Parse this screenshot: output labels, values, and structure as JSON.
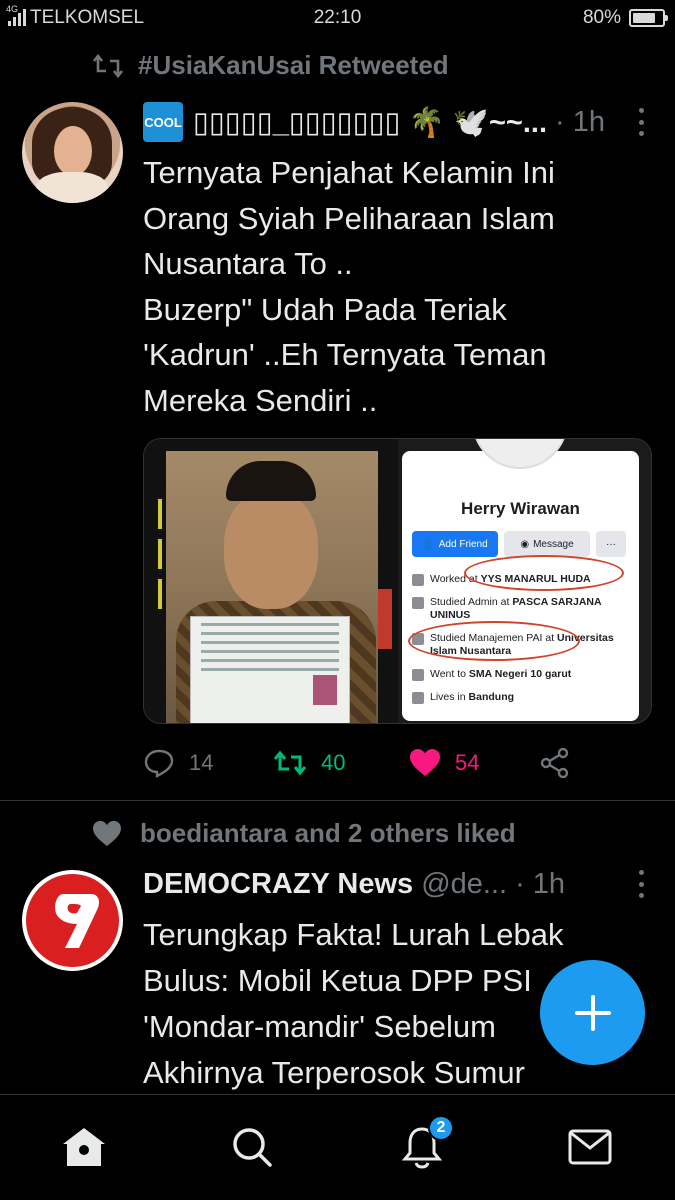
{
  "status_bar": {
    "network": "4G",
    "carrier": "TELKOMSEL",
    "time": "22:10",
    "battery": "80%",
    "battery_level": 0.8
  },
  "tweets": [
    {
      "social_context": "#UsiaKanUsai Retweeted",
      "display_name": "▯▯▯▯▯_▯▯▯▯▯▯▯ 🌴 🕊️~~...",
      "badge": "COOL",
      "separator": "·",
      "time": "1h",
      "text_lines": [
        "Ternyata Penjahat Kelamin Ini",
        "Orang Syiah Peliharaan Islam",
        "Nusantara To ..",
        "Buzerp\" Udah Pada Teriak",
        "'Kadrun' ..Eh Ternyata Teman",
        "Mereka Sendiri .."
      ],
      "media": {
        "profile_name": "Herry Wirawan",
        "add_friend": "Add Friend",
        "message": "Message",
        "more": "···",
        "details": [
          {
            "prefix": "Worked at ",
            "bold": "YYS MANARUL HUDA",
            "icon": "briefcase-icon"
          },
          {
            "prefix": "Studied Admin at ",
            "bold": "PASCA SARJANA UNINUS",
            "icon": "graduation-cap-icon"
          },
          {
            "prefix": "Studied Manajemen PAI at ",
            "bold": "Universitas Islam Nusantara",
            "icon": "graduation-cap-icon"
          },
          {
            "prefix": "Went to ",
            "bold": "SMA Negeri 10 garut",
            "icon": "graduation-cap-icon"
          },
          {
            "prefix": "Lives in ",
            "bold": "Bandung",
            "icon": "home-icon"
          }
        ]
      },
      "replies": "14",
      "retweets": "40",
      "likes": "54",
      "retweeted": true,
      "liked": true
    },
    {
      "social_context": "boediantara and 2 others liked",
      "display_name": "DEMOCRAZY News",
      "handle": "@de...",
      "separator": "·",
      "time": "1h",
      "text_lines": [
        "Terungkap Fakta! Lurah Lebak",
        "Bulus: Mobil Ketua DPP PSI",
        "'Mondar-mandir' Sebelum",
        "Akhirnya Terperosok Sumur"
      ]
    }
  ],
  "nav": {
    "notifications_badge": "2",
    "items": [
      "home-icon",
      "search-icon",
      "bell-icon",
      "mail-icon"
    ]
  },
  "colors": {
    "background": "#000000",
    "text": "#e7e9ea",
    "muted": "#71767b",
    "retweet": "#00ba7c",
    "like": "#f91880",
    "accent": "#1d9bf0"
  }
}
